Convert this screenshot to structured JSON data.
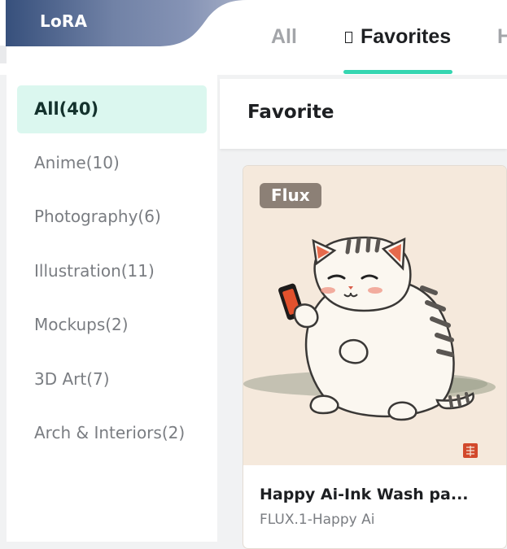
{
  "header": {
    "lora_label": "LoRA",
    "tabs": [
      {
        "label": "All"
      },
      {
        "label": "Favorites"
      },
      {
        "label": "H"
      }
    ],
    "active_tab_color": "#35d6b1"
  },
  "sidebar": {
    "items": [
      {
        "label": "All(40)"
      },
      {
        "label": "Anime(10)"
      },
      {
        "label": "Photography(6)"
      },
      {
        "label": "Illustration(11)"
      },
      {
        "label": "Mockups(2)"
      },
      {
        "label": "3D Art(7)"
      },
      {
        "label": "Arch & Interiors(2)"
      }
    ],
    "active_bg": "#dbf7ef"
  },
  "main": {
    "title": "Favorite",
    "cards": [
      {
        "badge": "Flux",
        "title": "Happy Ai-Ink Wash pa...",
        "subtitle": "FLUX.1-Happy Ai"
      }
    ]
  }
}
